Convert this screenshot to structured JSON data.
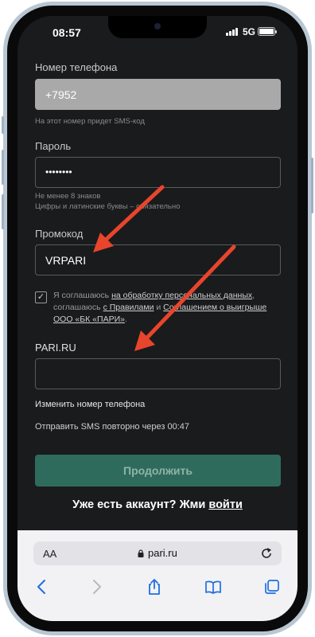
{
  "status": {
    "time": "08:57",
    "network": "5G"
  },
  "phone": {
    "label": "Номер телефона",
    "value": "+7952",
    "hint": "На этот номер придет SMS-код"
  },
  "password": {
    "label": "Пароль",
    "value": "••••••••",
    "hint_line1": "Не менее 8 знаков",
    "hint_line2": "Цифры и латинские буквы – обязательно"
  },
  "promo": {
    "label": "Промокод",
    "value": "VRPARI"
  },
  "consent": {
    "checked": true,
    "part1": "Я соглашаюсь ",
    "link1": "на обработку персональных данных",
    "part2": ", соглашаюсь ",
    "link2": "с Правилами",
    "part3": " и ",
    "link3": "Соглашением о выигрыше ООО «БК «ПАРИ»",
    "part4": "."
  },
  "sms_code": {
    "label": "PARI.RU",
    "value": ""
  },
  "change_phone": "Изменить номер телефона",
  "resend": "Отправить SMS повторно через 00:47",
  "continue_label": "Продолжить",
  "account": {
    "text": "Уже есть аккаунт? Жми ",
    "link": "войти"
  },
  "browser": {
    "aa_label": "AA",
    "url": "pari.ru"
  },
  "colors": {
    "accent": "#2f6b5c",
    "arrow": "#e8452c",
    "background": "#1a1b1d"
  }
}
